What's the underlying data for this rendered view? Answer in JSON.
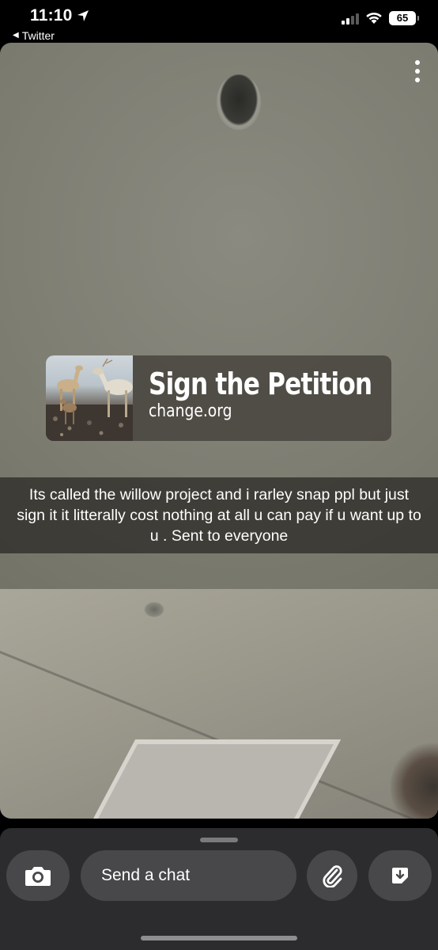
{
  "status_bar": {
    "time": "11:10",
    "back_app": "Twitter",
    "battery": "65"
  },
  "snap": {
    "petition": {
      "title": "Sign the Petition",
      "site": "change.org"
    },
    "caption": "Its called the willow project and i rarley snap ppl but just sign it it litterally cost nothing at all u can pay if u want up to u . Sent to everyone"
  },
  "chat_bar": {
    "input_placeholder": "Send a chat"
  },
  "icons": {
    "location": "location-arrow-icon",
    "camera": "camera-icon",
    "attach": "paperclip-icon",
    "sticker": "sticker-icon",
    "more": "more-vertical-icon"
  }
}
